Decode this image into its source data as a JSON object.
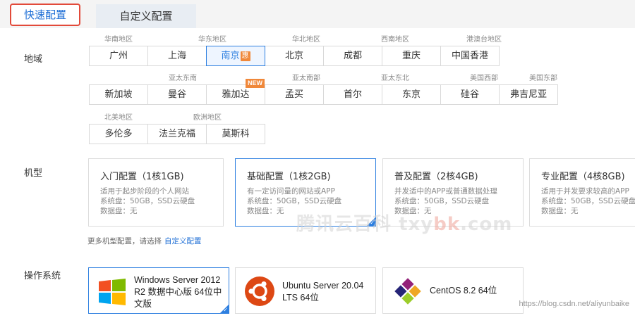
{
  "tabs": {
    "quick": "快速配置",
    "custom": "自定义配置"
  },
  "labels": {
    "region": "地域",
    "model": "机型",
    "os": "操作系统"
  },
  "regions": {
    "row1_groups": [
      "华南地区",
      "华东地区",
      "华北地区",
      "西南地区",
      "港澳台地区"
    ],
    "row1": [
      "广州",
      "上海",
      "南京",
      "北京",
      "成都",
      "重庆",
      "中国香港"
    ],
    "row1_selected_badge": "惠",
    "row2_groups": [
      "亚太东南",
      "亚太南部",
      "亚太东北",
      "美国西部",
      "美国东部"
    ],
    "row2": [
      "新加坡",
      "曼谷",
      "雅加达",
      "孟买",
      "首尔",
      "东京",
      "硅谷",
      "弗吉尼亚"
    ],
    "row2_new_badge": "NEW",
    "row3_groups": [
      "北美地区",
      "欧洲地区"
    ],
    "row3": [
      "多伦多",
      "法兰克福",
      "莫斯科"
    ]
  },
  "specs": [
    {
      "title": "入门配置（1核1GB)",
      "desc": "适用于起步阶段的个人网站",
      "sys": "系统盘：50GB，SSD云硬盘",
      "data": "数据盘：无"
    },
    {
      "title": "基础配置（1核2GB)",
      "desc": "有一定访问量的网站或APP",
      "sys": "系统盘：50GB，SSD云硬盘",
      "data": "数据盘：无"
    },
    {
      "title": "普及配置（2核4GB)",
      "desc": "并发适中的APP或普通数据处理",
      "sys": "系统盘：50GB，SSD云硬盘",
      "data": "数据盘：无"
    },
    {
      "title": "专业配置（4核8GB)",
      "desc": "适用于并发要求较高的APP",
      "sys": "系统盘：50GB，SSD云硬盘",
      "data": "数据盘：无"
    }
  ],
  "more": {
    "text": "更多机型配置，请选择",
    "link": "自定义配置"
  },
  "os": {
    "windows": {
      "line1": "Windows Server 2012",
      "line2": "R2 数据中心版 64位中",
      "line3": "文版"
    },
    "ubuntu": {
      "line1": "Ubuntu Server 20.04",
      "line2": "LTS 64位"
    },
    "centos": {
      "line1": "CentOS 8.2 64位"
    }
  },
  "watermark": {
    "cn": "腾讯云百科",
    "a": "txy",
    "b": "bk",
    "c": ".com"
  },
  "source_url": "https://blog.csdn.net/aliyunbaike",
  "colors": {
    "accent": "#2d7fe0",
    "badge": "#f0883a",
    "highlight_border": "#e24a3a"
  }
}
